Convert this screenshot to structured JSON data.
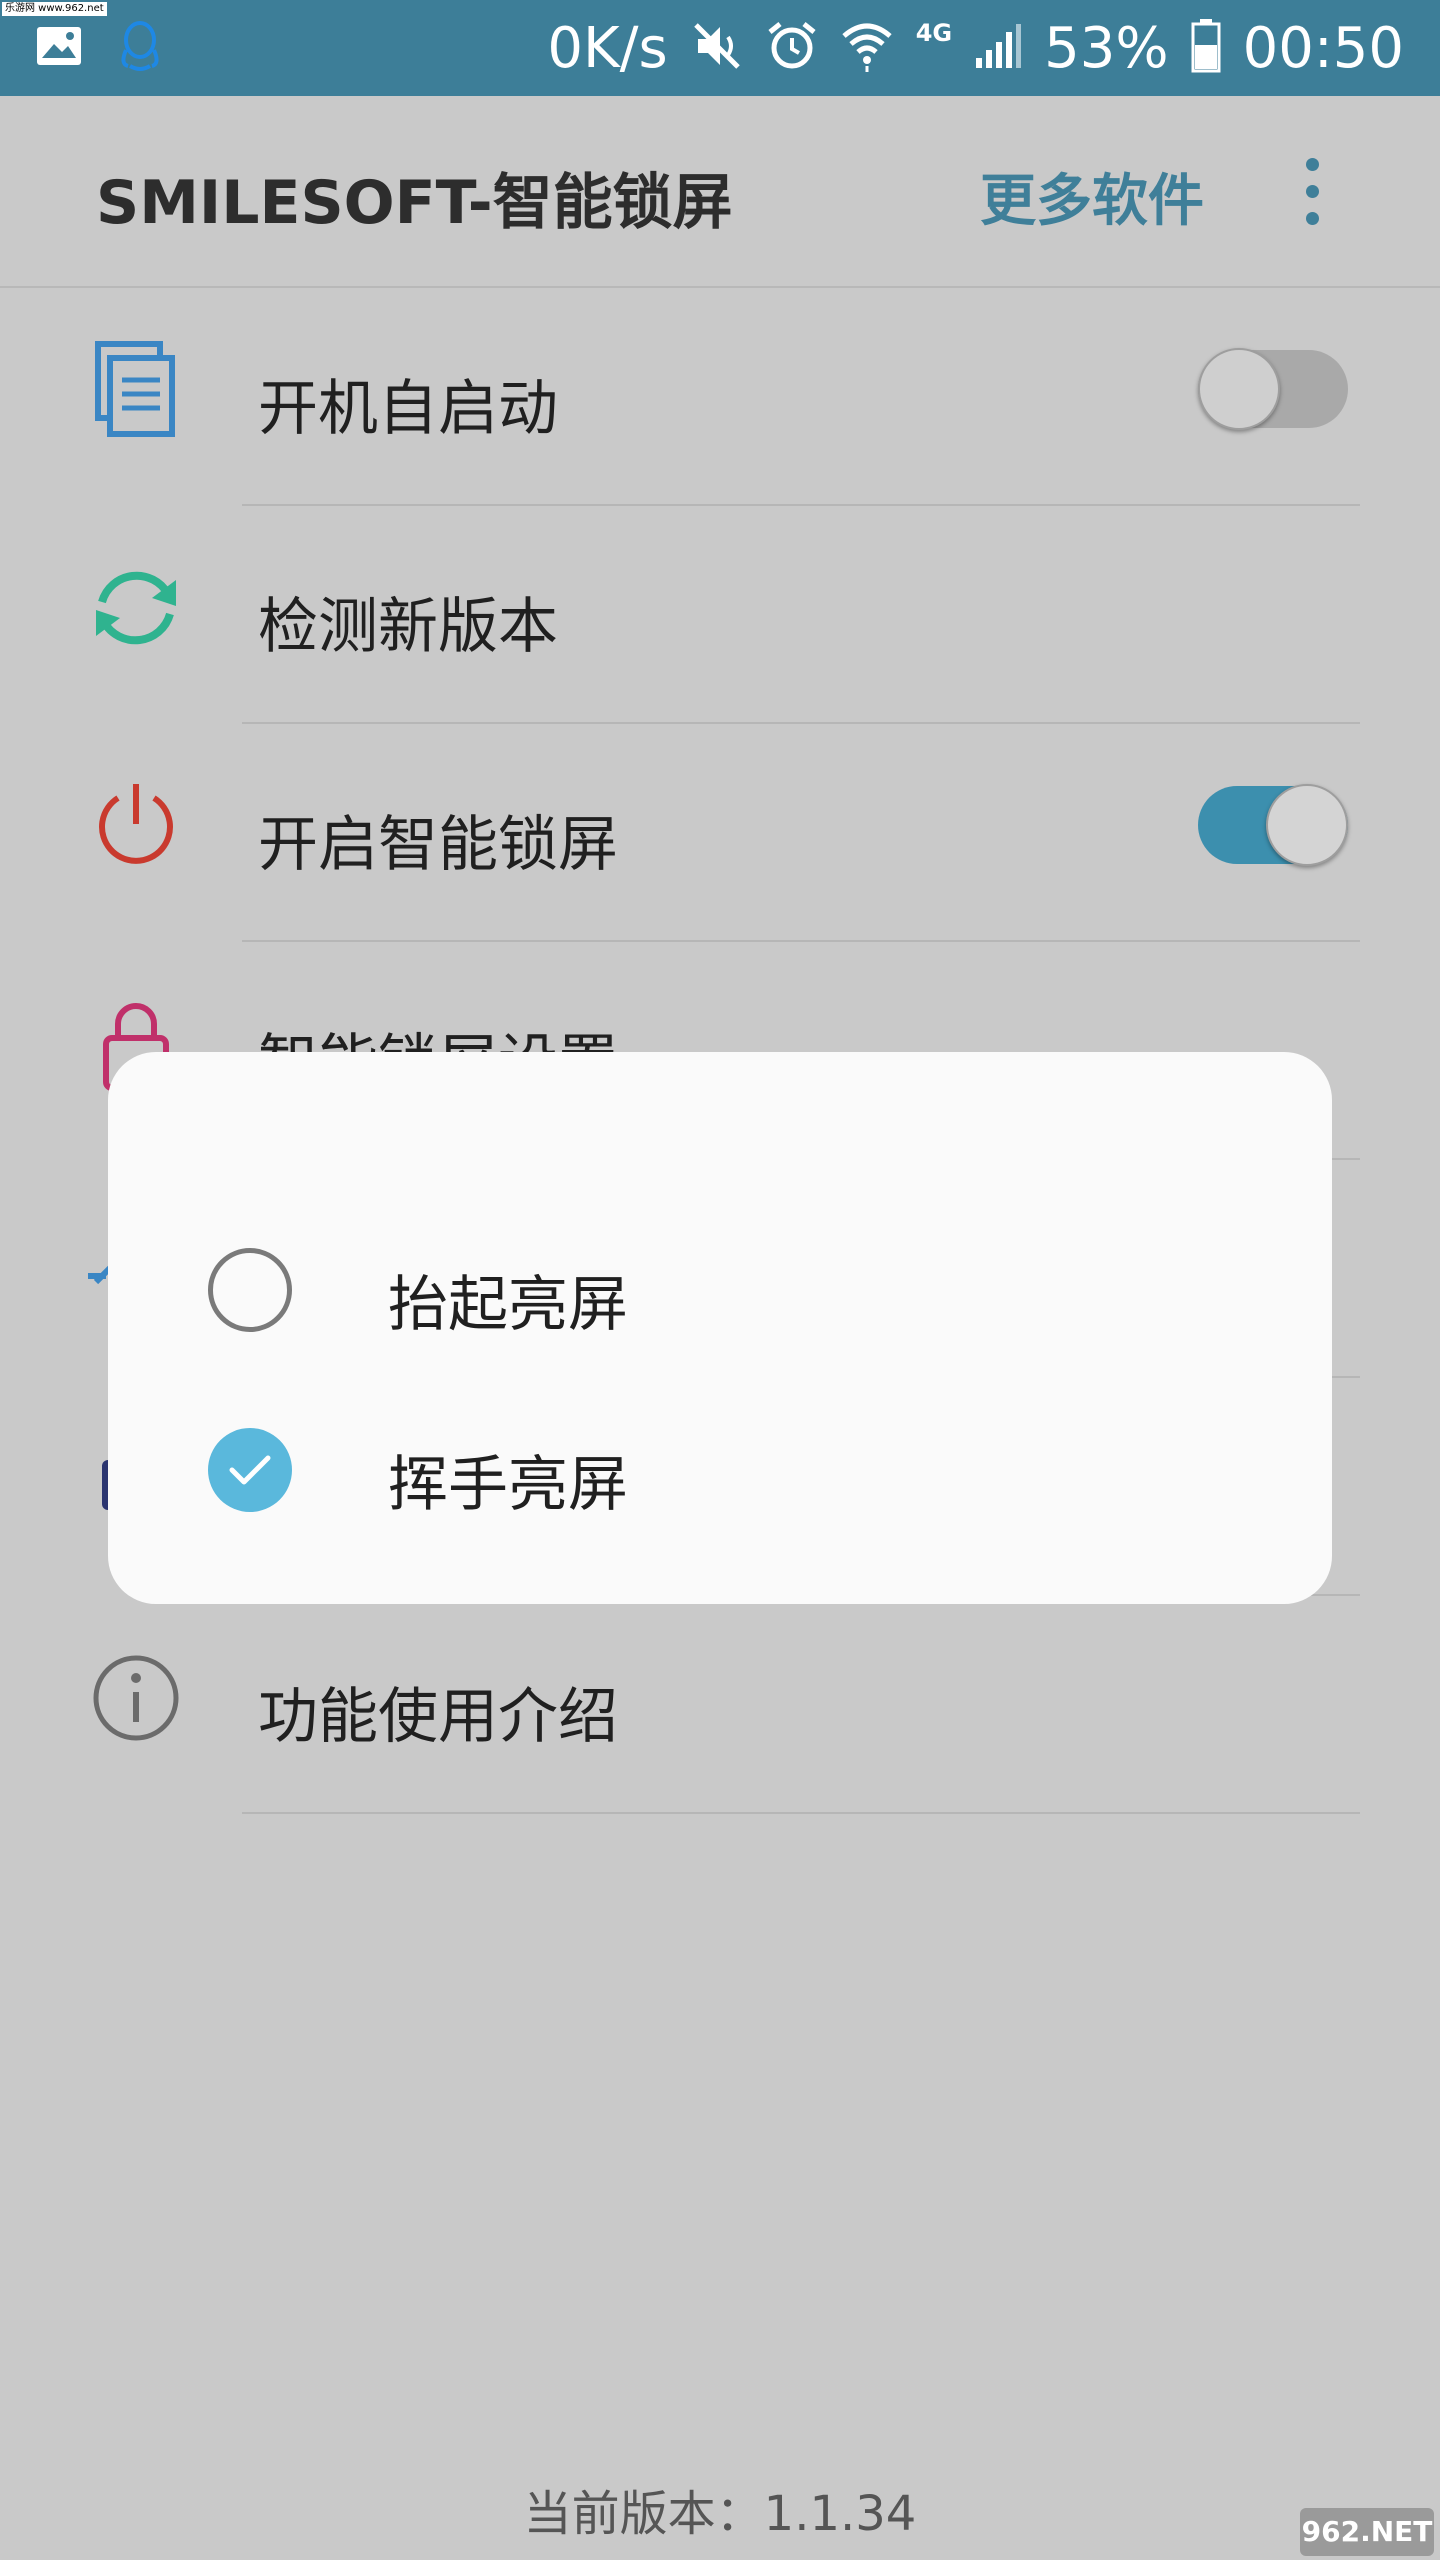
{
  "status_bar": {
    "net_speed": "0K/s",
    "network": "4G",
    "battery": "53%",
    "time": "00:50",
    "watermark": "乐游网 www.962.net",
    "icons": [
      "gallery-icon",
      "qq-icon",
      "mute-icon",
      "alarm-icon",
      "wifi-icon",
      "signal-icon",
      "battery-icon"
    ]
  },
  "app_bar": {
    "title": "SMILESOFT-智能锁屏",
    "more_software": "更多软件"
  },
  "settings": [
    {
      "label": "开机自启动",
      "icon": "document-copy-icon",
      "toggle": "off"
    },
    {
      "label": "检测新版本",
      "icon": "refresh-icon"
    },
    {
      "label": "开启智能锁屏",
      "icon": "power-icon",
      "toggle": "on"
    },
    {
      "label": "智能锁屏设置",
      "icon": "lock-icon"
    },
    {
      "label": "",
      "icon": "settings-icon"
    },
    {
      "label": "",
      "icon": "app-icon"
    },
    {
      "label": "功能使用介绍",
      "icon": "info-icon"
    }
  ],
  "dialog": {
    "options": [
      {
        "label": "抬起亮屏",
        "checked": false
      },
      {
        "label": "挥手亮屏",
        "checked": true
      }
    ]
  },
  "footer": {
    "version": "当前版本：1.1.34",
    "watermark": "962.NET"
  },
  "colors": {
    "accent": "#3c8fae",
    "status_bar": "#3d7e98",
    "check": "#5ab8dc"
  }
}
